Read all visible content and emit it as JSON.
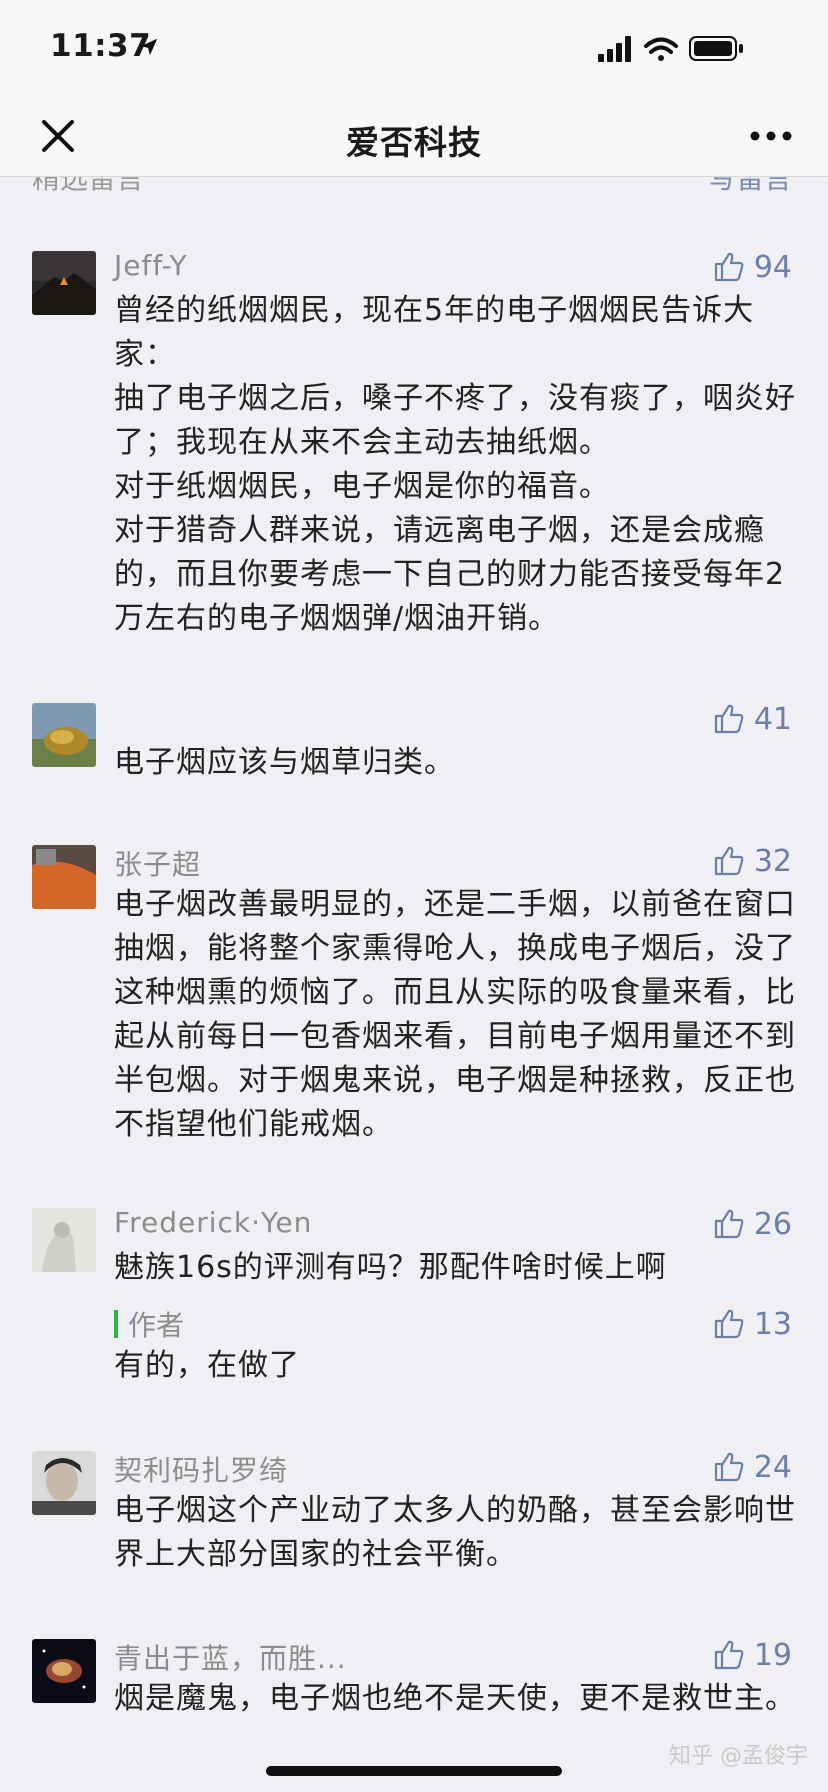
{
  "status": {
    "time": "11:37"
  },
  "nav": {
    "title": "爱否科技"
  },
  "section": {
    "left": "精选留言",
    "right": "写留言"
  },
  "comments": [
    {
      "name": "Jeff-Y",
      "likes": "94",
      "lines": [
        "曾经的纸烟烟民，现在5年的电子烟烟民告诉大家：",
        "抽了电子烟之后，嗓子不疼了，没有痰了，咽炎好了；我现在从来不会主动去抽纸烟。",
        "对于纸烟烟民，电子烟是你的福音。",
        "对于猎奇人群来说，请远离电子烟，还是会成瘾的，而且你要考虑一下自己的财力能否接受每年2万左右的电子烟烟弹/烟油开销。"
      ]
    },
    {
      "name": "",
      "likes": "41",
      "lines": [
        "电子烟应该与烟草归类。"
      ]
    },
    {
      "name": "张子超",
      "likes": "32",
      "lines": [
        "电子烟改善最明显的，还是二手烟，以前爸在窗口抽烟，能将整个家熏得呛人，换成电子烟后，没了这种烟熏的烦恼了。而且从实际的吸食量来看，比起从前每日一包香烟来看，目前电子烟用量还不到半包烟。对于烟鬼来说，电子烟是种拯救，反正也不指望他们能戒烟。"
      ]
    },
    {
      "name": "Frederick·Yen",
      "likes": "26",
      "lines": [
        "魅族16s的评测有吗？那配件啥时候上啊"
      ],
      "reply": {
        "label": "作者",
        "likes": "13",
        "text": "有的，在做了"
      }
    },
    {
      "name": "契利码扎罗绮",
      "likes": "24",
      "lines": [
        "电子烟这个产业动了太多人的奶酪，甚至会影响世界上大部分国家的社会平衡。"
      ]
    },
    {
      "name": "青出于蓝，而胜...",
      "likes": "19",
      "lines": [
        "烟是魔鬼，电子烟也绝不是天使，更不是救世主。"
      ]
    }
  ],
  "watermark": "知乎 @孟俊宇",
  "colors": {
    "accent": "#6b7fa8",
    "author_bar": "#2ab148",
    "background": "#efeff4"
  }
}
